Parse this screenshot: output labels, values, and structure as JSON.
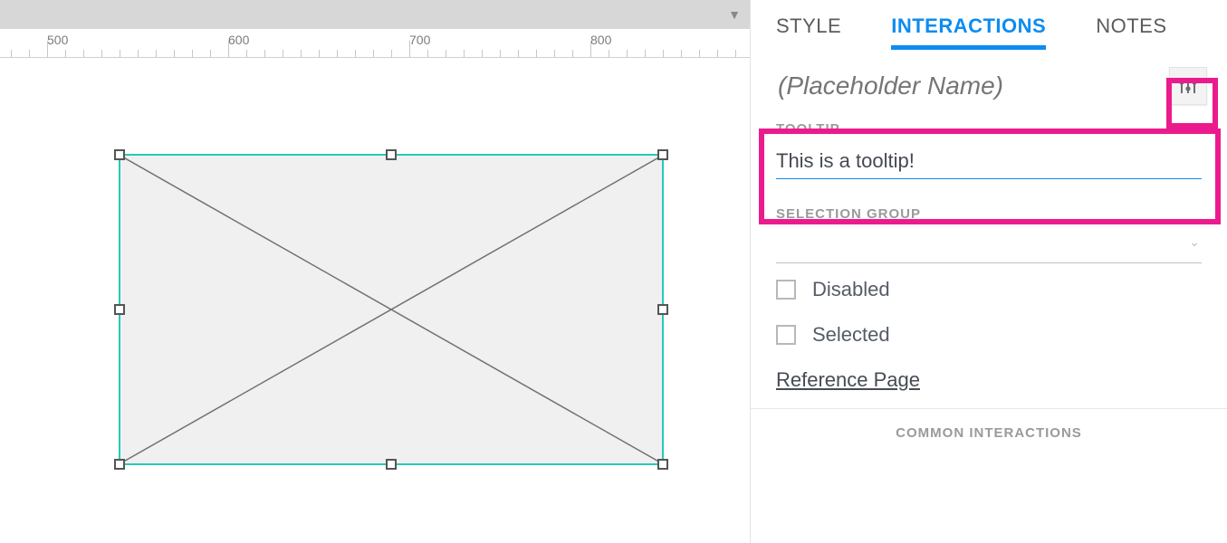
{
  "ruler": {
    "labels": [
      "500",
      "600",
      "700",
      "800"
    ],
    "start": 500,
    "spacing": 100,
    "pxPerUnit": 2
  },
  "tabs": {
    "style": "STYLE",
    "interactions": "INTERACTIONS",
    "notes": "NOTES"
  },
  "tooltip": {
    "label": "TOOLTIP",
    "value": "This is a tooltip!"
  },
  "selectionGroup": {
    "label": "SELECTION GROUP",
    "value": ""
  },
  "checks": {
    "disabled": "Disabled",
    "selected": "Selected"
  },
  "refLink": "Reference Page",
  "commonLabel": "COMMON INTERACTIONS",
  "name": {
    "placeholder": "(Placeholder Name)"
  }
}
